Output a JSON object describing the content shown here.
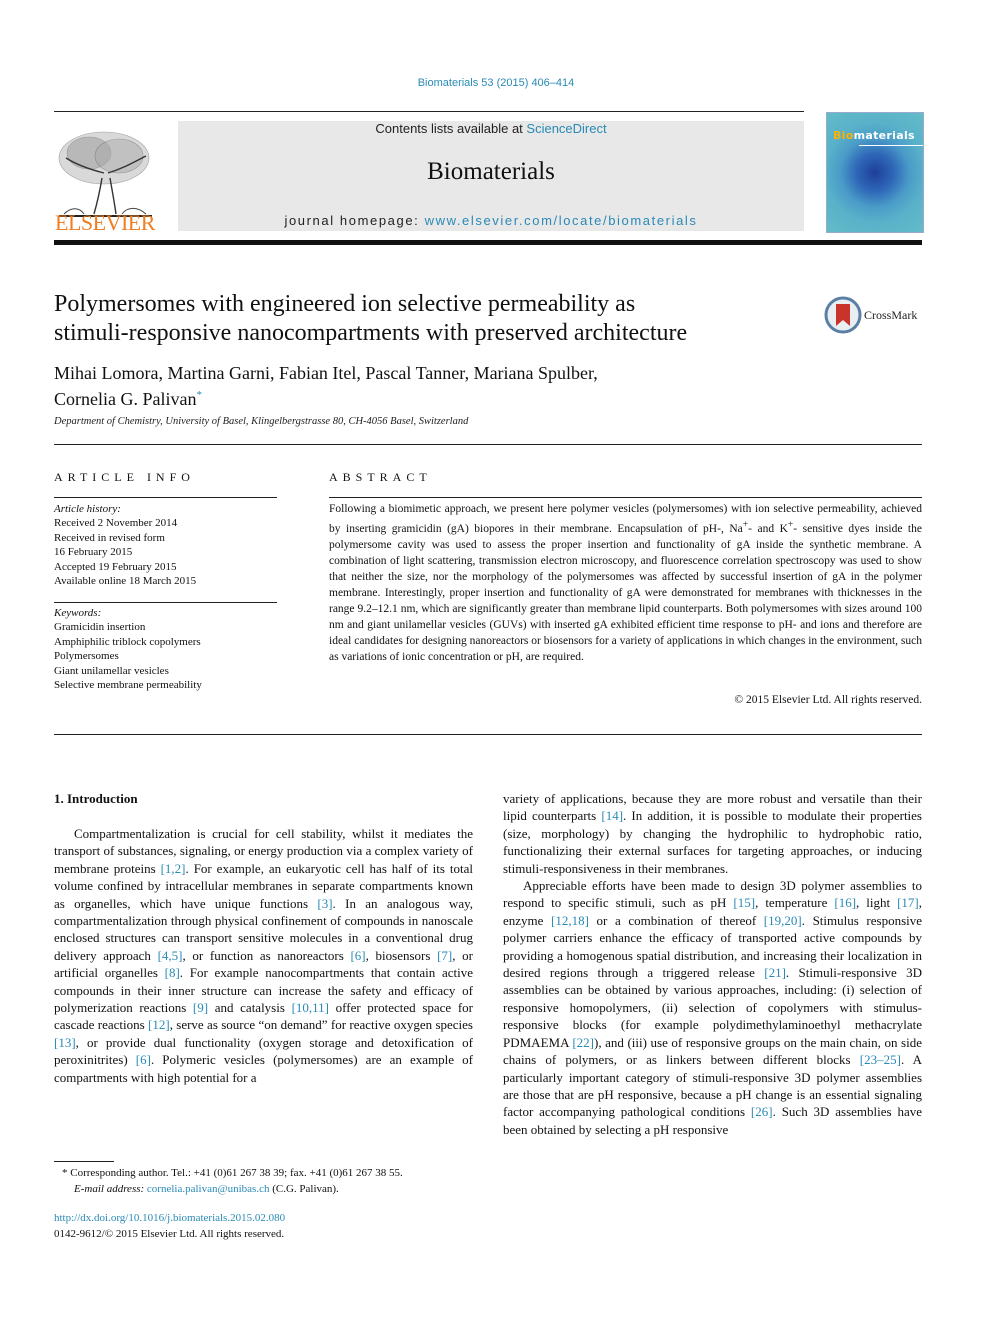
{
  "citation": "Biomaterials 53 (2015) 406–414",
  "masthead": {
    "publisher_logo_text": "ELSEVIER",
    "contents_prefix": "Contents lists available at ",
    "contents_link": "ScienceDirect",
    "journal_name": "Biomaterials",
    "homepage_prefix": "journal homepage: ",
    "homepage_link": "www.elsevier.com/locate/biomaterials",
    "cover_title_accent": "Bio",
    "cover_title_rest": "materials",
    "brand_orange": "#f07e22",
    "link_blue": "#2a8ab6"
  },
  "crossmark_label": "CrossMark",
  "title_line1": "Polymersomes with engineered ion selective permeability as",
  "title_line2": "stimuli-responsive nanocompartments with preserved architecture",
  "authors_line1": "Mihai Lomora, Martina Garni, Fabian Itel, Pascal Tanner, Mariana Spulber,",
  "authors_line2": "Cornelia G. Palivan",
  "authors_mark": "*",
  "affiliation": "Department of Chemistry, University of Basel, Klingelbergstrasse 80, CH-4056 Basel, Switzerland",
  "article_info": {
    "heading": "ARTICLE INFO",
    "history_label": "Article history:",
    "history": [
      "Received 2 November 2014",
      "Received in revised form",
      "16 February 2015",
      "Accepted 19 February 2015",
      "Available online 18 March 2015"
    ],
    "keywords_label": "Keywords:",
    "keywords": [
      "Gramicidin insertion",
      "Amphiphilic triblock copolymers",
      "Polymersomes",
      "Giant unilamellar vesicles",
      "Selective membrane permeability"
    ]
  },
  "abstract": {
    "heading": "ABSTRACT",
    "text_a": "Following a biomimetic approach, we present here polymer vesicles (polymersomes) with ion selective permeability, achieved by inserting gramicidin (gA) biopores in their membrane. Encapsulation of pH-, Na",
    "sup1": "+",
    "text_b": "- and K",
    "sup2": "+",
    "text_c": "- sensitive dyes inside the polymersome cavity was used to assess the proper insertion and functionality of gA inside the synthetic membrane. A combination of light scattering, transmission electron microscopy, and fluorescence correlation spectroscopy was used to show that neither the size, nor the morphology of the polymersomes was affected by successful insertion of gA in the polymer membrane. Interestingly, proper insertion and functionality of gA were demonstrated for membranes with thicknesses in the range 9.2‒12.1 nm, which are significantly greater than membrane lipid counterparts. Both polymersomes with sizes around 100 nm and giant unilamellar vesicles (GUVs) with inserted gA exhibited efficient time response to pH- and ions and therefore are ideal candidates for designing nanoreactors or biosensors for a variety of applications in which changes in the environment, such as variations of ionic concentration or pH, are required.",
    "copyright": "© 2015 Elsevier Ltd. All rights reserved."
  },
  "intro": {
    "heading": "1.  Introduction",
    "left_para": [
      {
        "t": "Compartmentalization is crucial for cell stability, whilst it mediates the transport of substances, signaling, or energy production via a complex variety of membrane proteins "
      },
      {
        "r": "[1,2]"
      },
      {
        "t": ". For example, an eukaryotic cell has half of its total volume confined by intracellular membranes in separate compartments known as organelles, which have unique functions "
      },
      {
        "r": "[3]"
      },
      {
        "t": ". In an analogous way, compartmentalization through physical confinement of compounds in nanoscale enclosed structures can transport sensitive molecules in a conventional drug delivery approach "
      },
      {
        "r": "[4,5]"
      },
      {
        "t": ", or function as nanoreactors "
      },
      {
        "r": "[6]"
      },
      {
        "t": ", biosensors "
      },
      {
        "r": "[7]"
      },
      {
        "t": ", or artificial organelles "
      },
      {
        "r": "[8]"
      },
      {
        "t": ". For example nanocompartments that contain active compounds in their inner structure can increase the safety and efficacy of polymerization reactions "
      },
      {
        "r": "[9]"
      },
      {
        "t": " and catalysis "
      },
      {
        "r": "[10,11]"
      },
      {
        "t": " offer protected space for cascade reactions "
      },
      {
        "r": "[12]"
      },
      {
        "t": ", serve as source “on demand” for reactive oxygen species "
      },
      {
        "r": "[13]"
      },
      {
        "t": ", or provide dual functionality (oxygen storage and detoxification of peroxinitrites) "
      },
      {
        "r": "[6]"
      },
      {
        "t": ". Polymeric vesicles (polymersomes) are an example of compartments with high potential for a"
      }
    ],
    "right_para1": [
      {
        "t": "variety of applications, because they are more robust and versatile than their lipid counterparts "
      },
      {
        "r": "[14]"
      },
      {
        "t": ". In addition, it is possible to modulate their properties (size, morphology) by changing the hydrophilic to hydrophobic ratio, functionalizing their external surfaces for targeting approaches, or inducing stimuli-responsiveness in their membranes."
      }
    ],
    "right_para2": [
      {
        "t": "Appreciable efforts have been made to design 3D polymer assemblies to respond to specific stimuli, such as pH "
      },
      {
        "r": "[15]"
      },
      {
        "t": ", temperature "
      },
      {
        "r": "[16]"
      },
      {
        "t": ", light "
      },
      {
        "r": "[17]"
      },
      {
        "t": ", enzyme "
      },
      {
        "r": "[12,18]"
      },
      {
        "t": " or a combination of thereof "
      },
      {
        "r": "[19,20]"
      },
      {
        "t": ". Stimulus responsive polymer carriers enhance the efficacy of transported active compounds by providing a homogenous spatial distribution, and increasing their localization in desired regions through a triggered release "
      },
      {
        "r": "[21]"
      },
      {
        "t": ". Stimuli-responsive 3D assemblies can be obtained by various approaches, including: (i) selection of responsive homopolymers, (ii) selection of copolymers with stimulus-responsive blocks (for example polydimethylaminoethyl methacrylate PDMAEMA "
      },
      {
        "r": "[22]"
      },
      {
        "t": "), and (iii) use of responsive groups on the main chain, on side chains of polymers, or as linkers between different blocks "
      },
      {
        "r": "[23‒25]"
      },
      {
        "t": ". A particularly important category of stimuli-responsive 3D polymer assemblies are those that are pH responsive, because a pH change is an essential signaling factor accompanying pathological conditions "
      },
      {
        "r": "[26]"
      },
      {
        "t": ". Such 3D assemblies have been obtained by selecting a pH responsive"
      }
    ]
  },
  "footnote": {
    "mark": "*",
    "corresponding": " Corresponding author. Tel.: +41 (0)61 267 38 39; fax. +41 (0)61 267 38 55.",
    "email_label": "E-mail address: ",
    "email": "cornelia.palivan@unibas.ch",
    "email_suffix": " (C.G. Palivan)."
  },
  "doi": "http://dx.doi.org/10.1016/j.biomaterials.2015.02.080",
  "issn_line": "0142-9612/© 2015 Elsevier Ltd. All rights reserved."
}
